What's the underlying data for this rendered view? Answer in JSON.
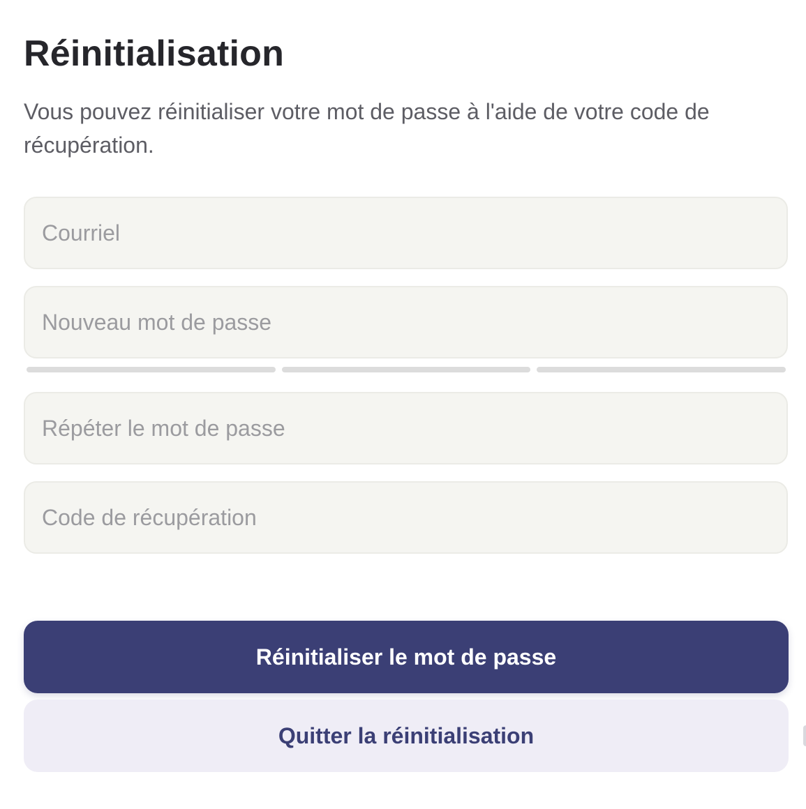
{
  "header": {
    "title": "Réinitialisation",
    "description": "Vous pouvez réinitialiser votre mot de passe à l'aide de votre code de récupération."
  },
  "form": {
    "email_placeholder": "Courriel",
    "new_password_placeholder": "Nouveau mot de passe",
    "repeat_password_placeholder": "Répéter le mot de passe",
    "recovery_code_placeholder": "Code de récupération",
    "password_strength": {
      "segments": 3,
      "filled": 0
    }
  },
  "actions": {
    "reset_label": "Réinitialiser le mot de passe",
    "quit_label": "Quitter la réinitialisation"
  },
  "colors": {
    "primary": "#3b3f75",
    "secondary_bg": "#efedf6",
    "field_bg": "#f5f5f1",
    "strength_empty": "#dcdcdc"
  }
}
